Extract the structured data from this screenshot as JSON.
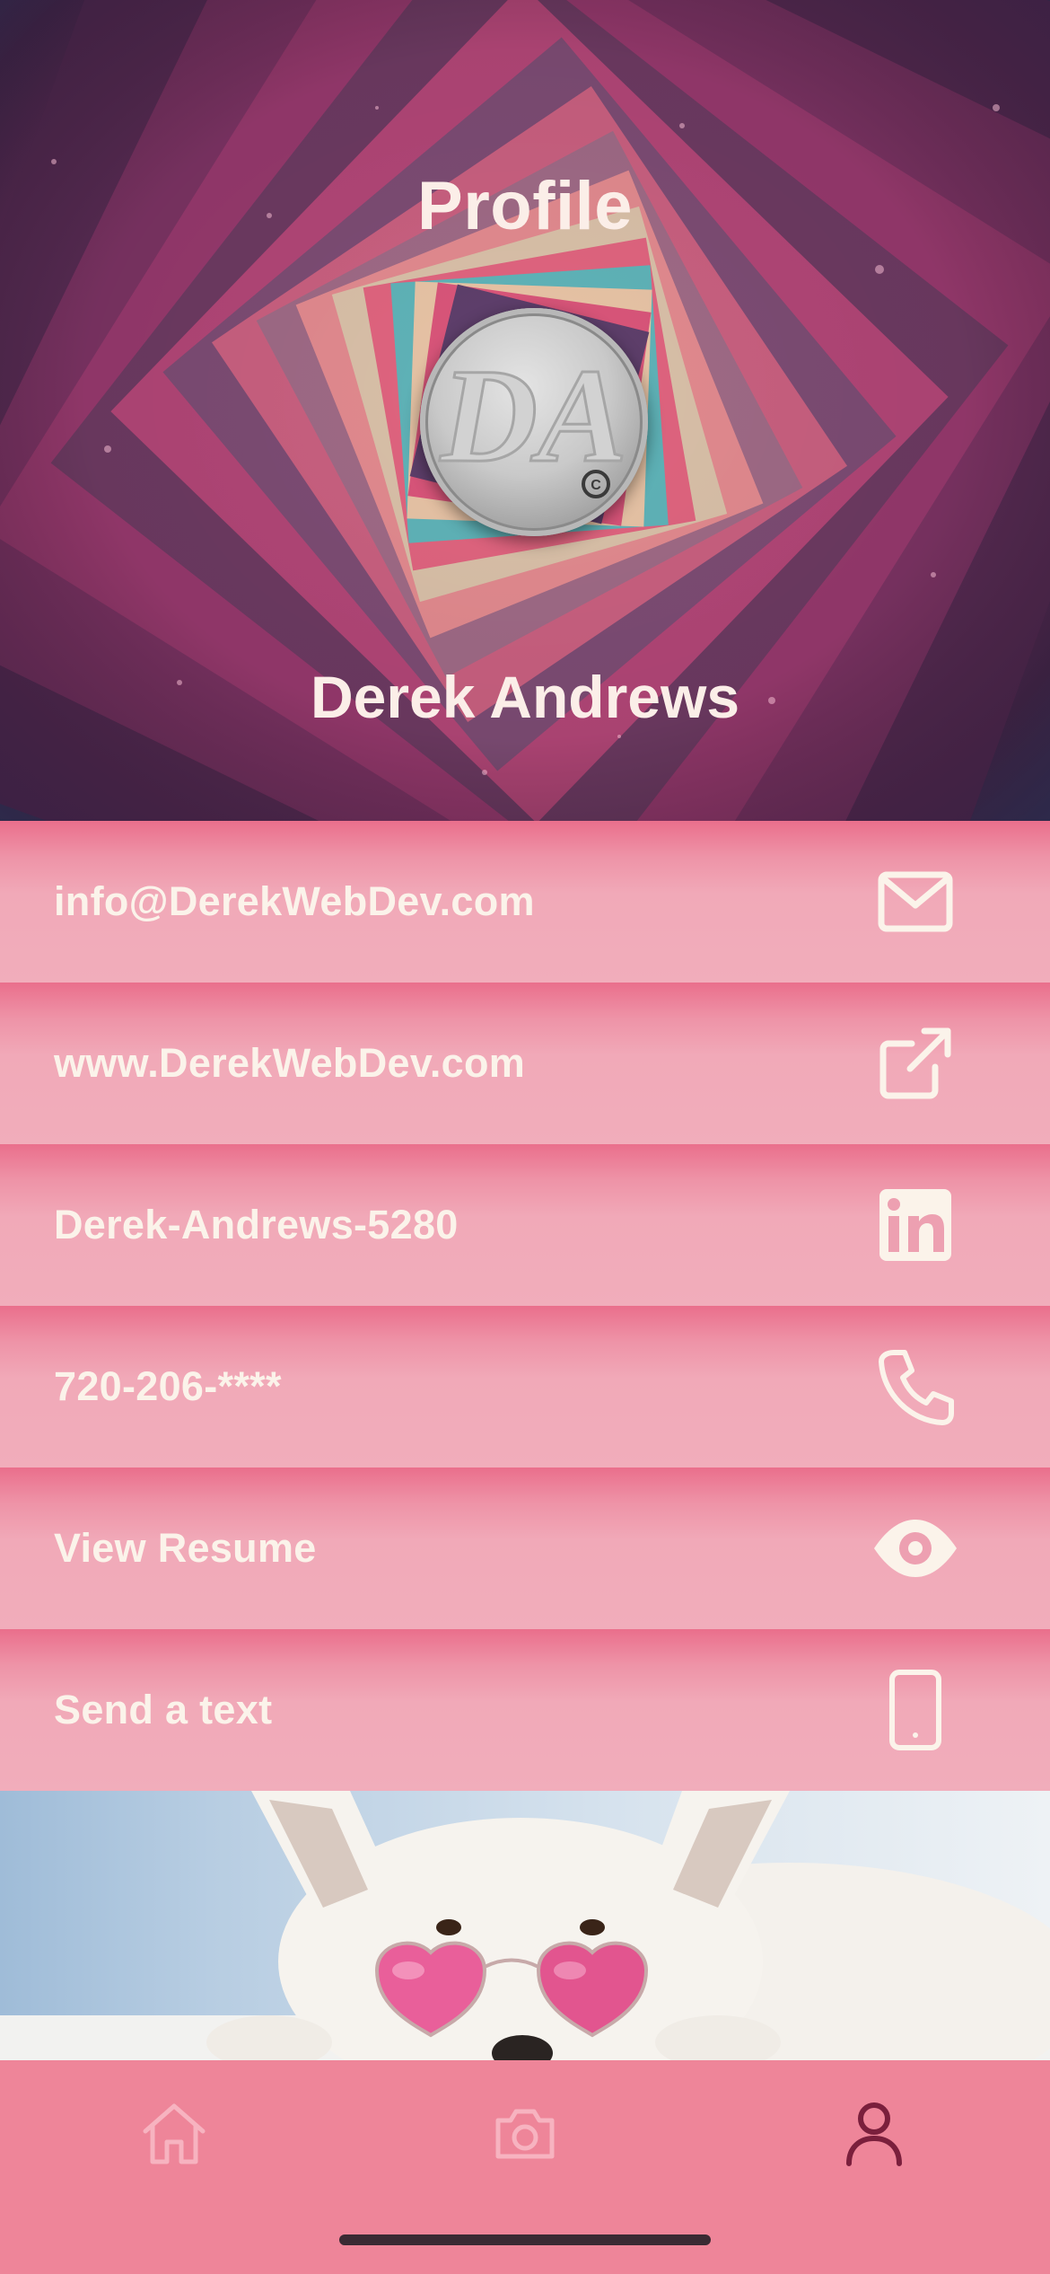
{
  "header": {
    "title": "Profile",
    "name": "Derek Andrews",
    "avatar_monogram": "DA"
  },
  "contacts": [
    {
      "label": "info@DerekWebDev.com",
      "icon": "mail-icon"
    },
    {
      "label": "www.DerekWebDev.com",
      "icon": "external-link-icon"
    },
    {
      "label": "Derek-Andrews-5280",
      "icon": "linkedin-icon"
    },
    {
      "label": "720-206-****",
      "icon": "phone-icon"
    },
    {
      "label": "View Resume",
      "icon": "eye-icon"
    },
    {
      "label": "Send a text",
      "icon": "mobile-phone-icon"
    }
  ],
  "tabbar": {
    "items": [
      {
        "icon": "home-icon",
        "active": false
      },
      {
        "icon": "camera-icon",
        "active": false
      },
      {
        "icon": "person-icon",
        "active": true
      }
    ]
  },
  "colors": {
    "text_light": "#fbf3ea",
    "row_top": "#ea6f8c",
    "row_bottom": "#f1adbb",
    "tabbar_bg": "#ee8599",
    "tab_inactive": "#f7b3c0",
    "tab_active": "#7a1f3c"
  }
}
